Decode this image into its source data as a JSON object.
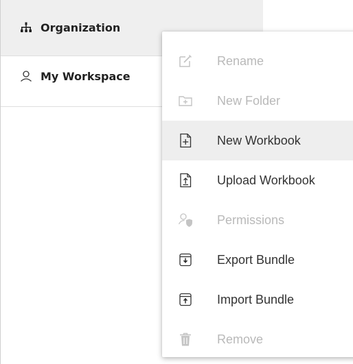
{
  "nav": {
    "items": [
      {
        "label": "Organization",
        "icon": "org-chart-icon"
      },
      {
        "label": "My Workspace",
        "icon": "user-icon"
      }
    ]
  },
  "context_menu": {
    "items": [
      {
        "label": "Rename",
        "icon": "edit-icon",
        "enabled": false
      },
      {
        "label": "New Folder",
        "icon": "new-folder-icon",
        "enabled": false
      },
      {
        "label": "New Workbook",
        "icon": "new-workbook-icon",
        "enabled": true,
        "highlighted": true
      },
      {
        "label": "Upload Workbook",
        "icon": "upload-workbook-icon",
        "enabled": true
      },
      {
        "label": "Permissions",
        "icon": "permissions-icon",
        "enabled": false
      },
      {
        "label": "Export Bundle",
        "icon": "export-bundle-icon",
        "enabled": true
      },
      {
        "label": "Import Bundle",
        "icon": "import-bundle-icon",
        "enabled": true
      },
      {
        "label": "Remove",
        "icon": "trash-icon",
        "enabled": false
      }
    ]
  },
  "colors": {
    "enabled_text": "#333333",
    "disabled_text": "#b9b9b9",
    "highlight_bg": "#eeeeee",
    "selected_nav_bg": "#efefef"
  }
}
